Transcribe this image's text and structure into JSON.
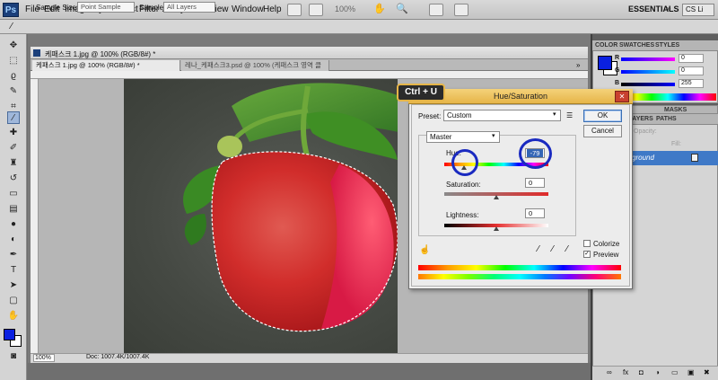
{
  "menubar": {
    "logo": "Ps",
    "items": [
      "File",
      "Edit",
      "Image",
      "Layer",
      "Select",
      "Filter",
      "Analysis",
      "3D",
      "View",
      "Window",
      "Help"
    ],
    "zoom": "100%",
    "workspace": "ESSENTIALS",
    "cs_live": "CS Li"
  },
  "options": {
    "sample_size_label": "Sample Size:",
    "sample_size_value": "Point Sample",
    "sample_label": "Sample:",
    "sample_value": "All Layers"
  },
  "document": {
    "title": "케패스크 1.jpg @ 100% (RGB/8#) *",
    "tabs": [
      {
        "label": "케패스크 1.jpg @ 100% (RGB/8#) *"
      },
      {
        "label": "레나_케패스크3.psd @ 100% (케패스크 영역 클릭, RGB/8)"
      }
    ],
    "tab_more": "»",
    "zoom": "100%",
    "doc_info": "Doc: 1007.4K/1007.4K"
  },
  "color_panel": {
    "tabs": [
      "COLOR",
      "SWATCHES",
      "STYLES"
    ],
    "channels": [
      {
        "name": "R",
        "value": "0"
      },
      {
        "name": "G",
        "value": "0"
      },
      {
        "name": "B",
        "value": "255"
      }
    ],
    "fg_color": "#0a20e0",
    "bg_color": "#ffffff"
  },
  "layers_panel": {
    "tabs": [
      "MASKS",
      "LAYERS",
      "PATHS"
    ],
    "opacity_label": "Opacity:",
    "fill_label": "Fill:",
    "layer_name": "ground"
  },
  "dialog": {
    "title": "Hue/Saturation",
    "preset_label": "Preset:",
    "preset_value": "Custom",
    "ok_label": "OK",
    "cancel_label": "Cancel",
    "edit_value": "Master",
    "hue_label": "Hue:",
    "hue_value": "-79",
    "saturation_label": "Saturation:",
    "saturation_value": "0",
    "lightness_label": "Lightness:",
    "lightness_value": "0",
    "colorize_label": "Colorize",
    "preview_label": "Preview",
    "colorize_checked": false,
    "preview_checked": true
  },
  "annotation": {
    "shortcut": "Ctrl + U",
    "highlight_color": "#1a2ac0"
  }
}
